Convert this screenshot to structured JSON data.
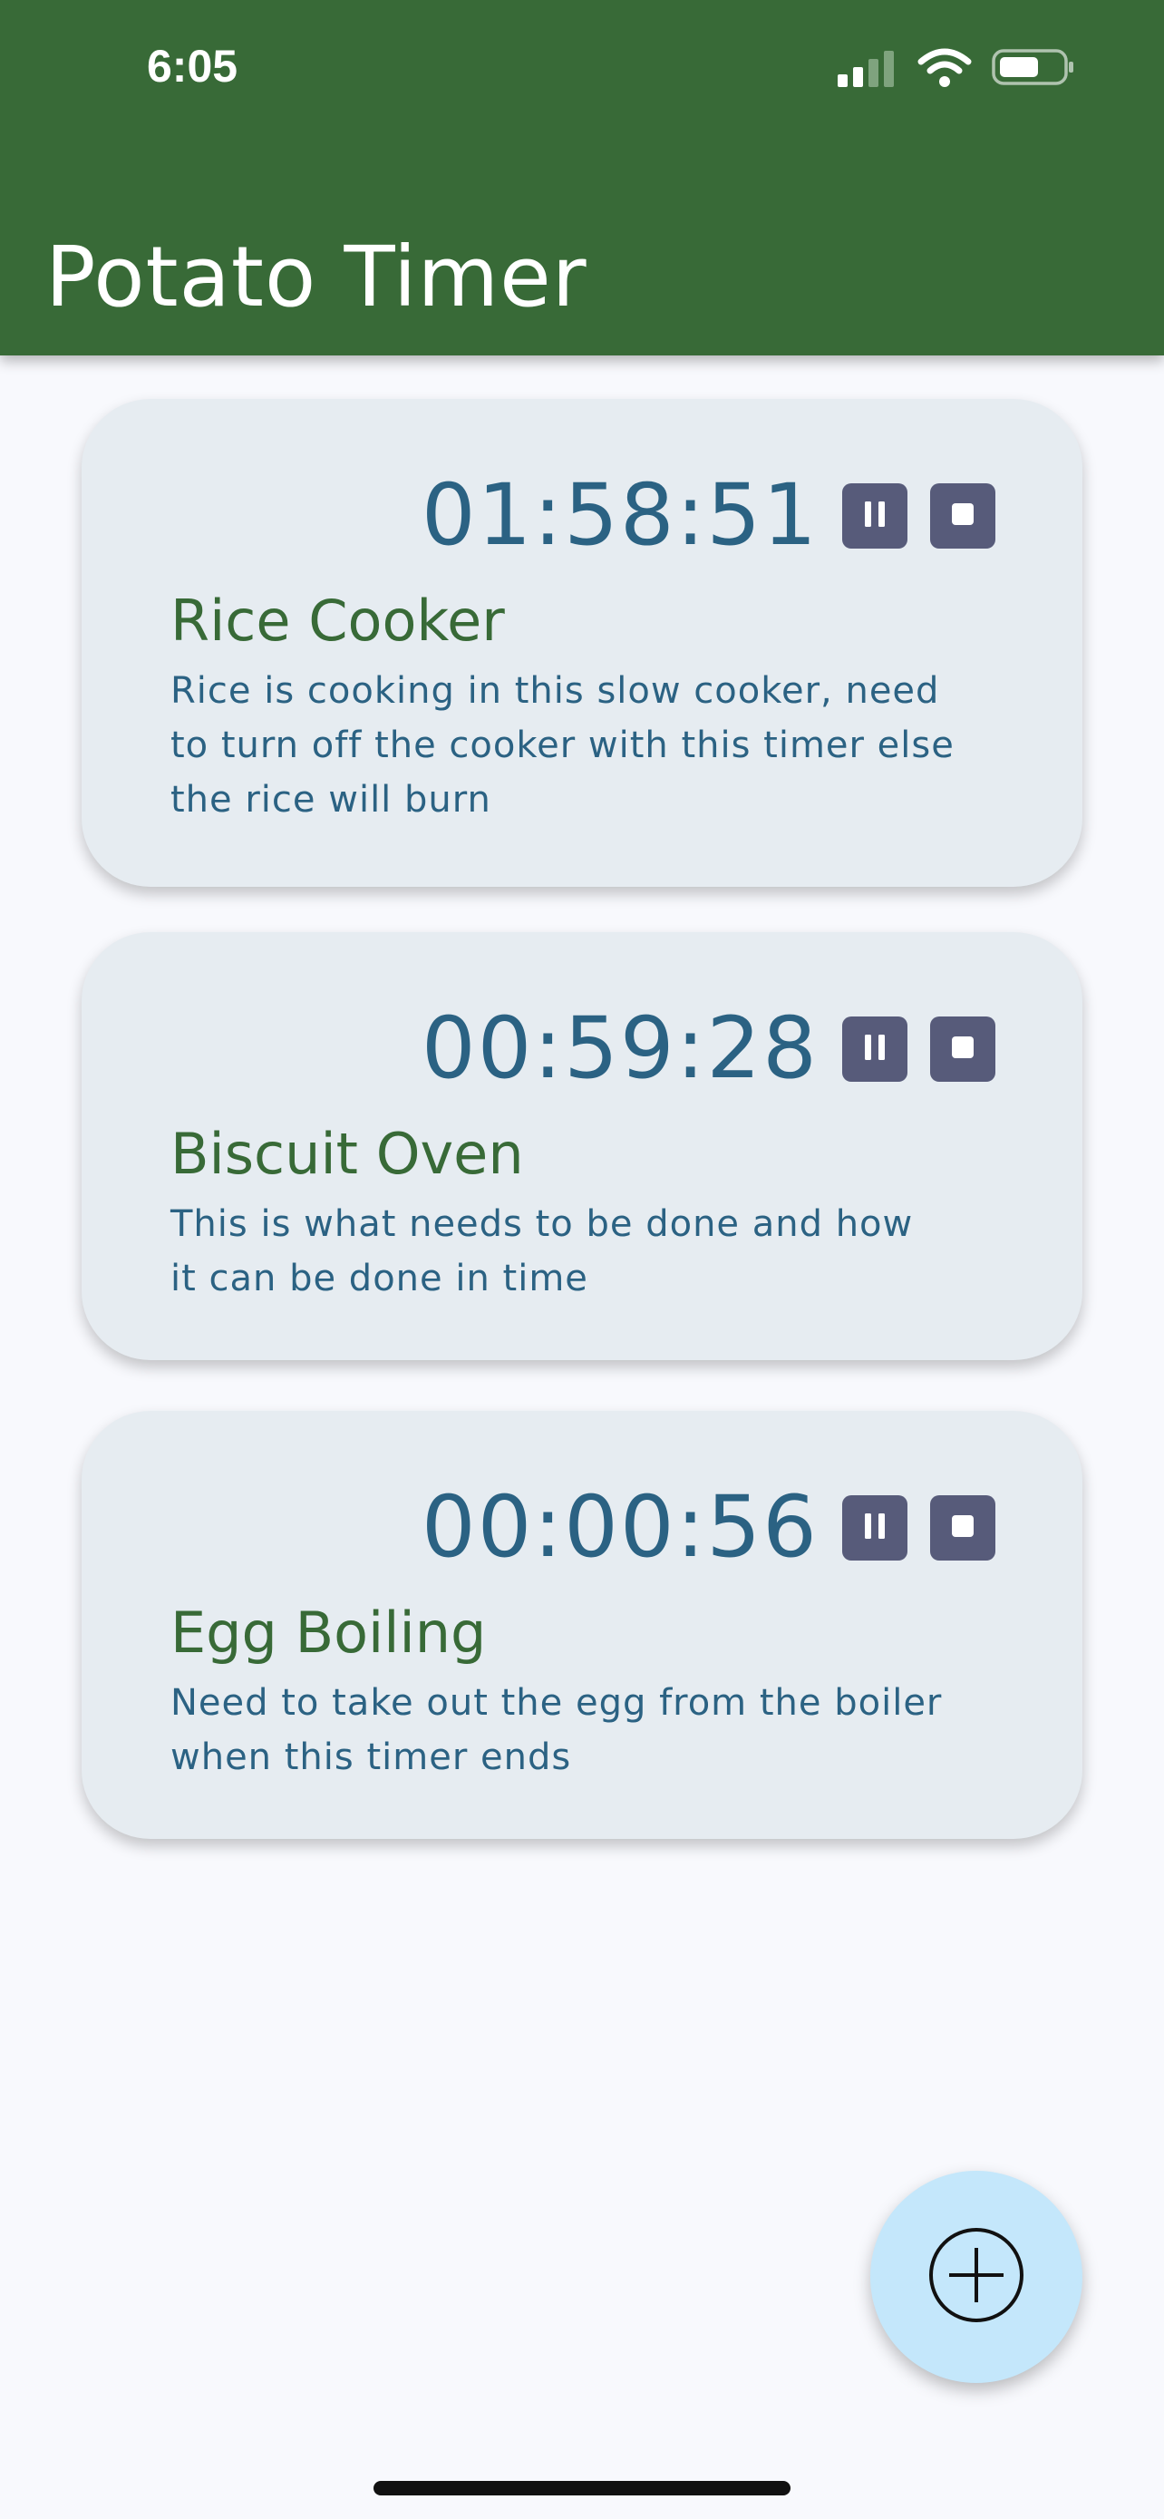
{
  "status_bar": {
    "time": "6:05"
  },
  "app_bar": {
    "title": "Potato Timer"
  },
  "timers": [
    {
      "time": "01:58:51",
      "title": "Rice Cooker",
      "description": "Rice is cooking in this slow cooker, need to turn off the cooker with this timer else the rice will burn"
    },
    {
      "time": "00:59:28",
      "title": "Biscuit Oven",
      "description": "This is what needs to be done and how it can be done in time"
    },
    {
      "time": "00:00:56",
      "title": "Egg Boiling",
      "description": "Need to take out the egg from the boiler when this timer ends"
    }
  ],
  "icons": {
    "pause": "pause-icon",
    "stop": "stop-icon",
    "add": "add-circle-icon"
  },
  "colors": {
    "app_bar": "#386a37",
    "card": "#e6ecf1",
    "timer_text": "#2b6283",
    "title_text": "#386a37",
    "control_button": "#575b7a",
    "fab": "#c4e7fb"
  }
}
